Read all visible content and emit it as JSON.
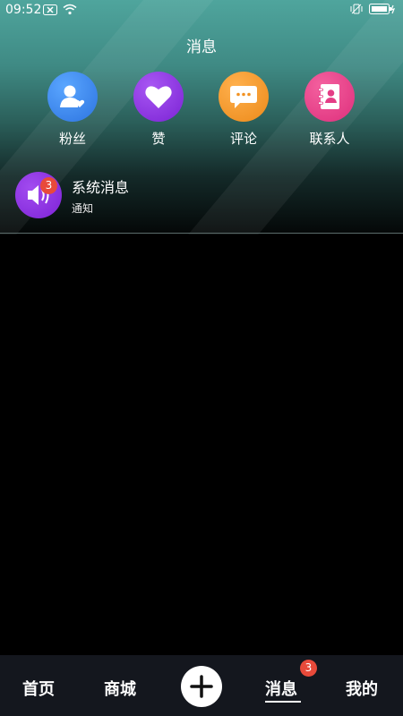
{
  "status_bar": {
    "time": "09:52"
  },
  "page": {
    "title": "消息"
  },
  "categories": [
    {
      "label": "粉丝",
      "icon": "user-heart-icon",
      "color": "#3d8bef"
    },
    {
      "label": "赞",
      "icon": "heart-icon",
      "color": "#8d33e6"
    },
    {
      "label": "评论",
      "icon": "chat-bubble-icon",
      "color": "#f49a2c"
    },
    {
      "label": "联系人",
      "icon": "contact-book-icon",
      "color": "#e7448f"
    }
  ],
  "messages": [
    {
      "title": "系统消息",
      "subtitle": "通知",
      "badge": "3",
      "icon": "speaker-icon"
    }
  ],
  "bottom_nav": {
    "items": [
      "首页",
      "商城",
      "消息",
      "我的"
    ],
    "active": "消息",
    "badge": "3",
    "plus_icon": "plus-icon"
  },
  "colors": {
    "badge": "#e84a3a",
    "nav_bg": "#14171e"
  }
}
